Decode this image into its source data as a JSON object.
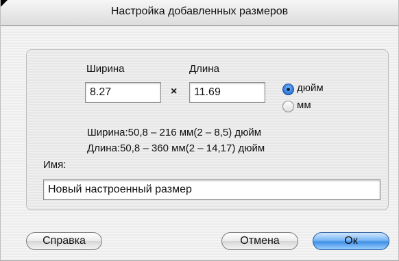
{
  "dialog": {
    "title": "Настройка добавленных размеров"
  },
  "size": {
    "width_label": "Ширина",
    "length_label": "Длина",
    "width_value": "8.27",
    "length_value": "11.69",
    "times_symbol": "×",
    "unit_options": [
      {
        "label": "дюйм",
        "selected": true
      },
      {
        "label": "мм",
        "selected": false
      }
    ],
    "width_range": "Ширина:50,8 – 216 мм(2 – 8,5) дюйм",
    "length_range": "Длина:50,8 – 360 мм(2 – 14,17) дюйм"
  },
  "name": {
    "label": "Имя:",
    "value": "Новый настроенный размер"
  },
  "buttons": {
    "help": "Справка",
    "cancel": "Отмена",
    "ok": "Ок"
  },
  "colors": {
    "default_button": "#3f8fe6",
    "selected_radio": "#2f7de1"
  }
}
